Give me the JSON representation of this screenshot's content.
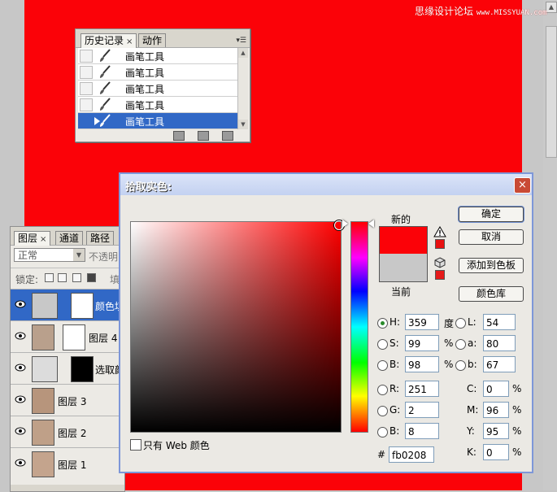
{
  "watermark": {
    "cn": "思缘设计论坛",
    "url": "www.MISSYUAN.com"
  },
  "colors": {
    "current_fg": "#fb0208",
    "previous": "#c8c8c8",
    "warn_swatch": "#e81010",
    "cube_swatch": "#e51a1a",
    "selection": "#3168c6"
  },
  "history_panel": {
    "tabs": [
      {
        "label": "历史记录",
        "close": "×"
      },
      {
        "label": "动作"
      }
    ],
    "menu_icon": "panel-menu-icon",
    "items": [
      {
        "label": "画笔工具"
      },
      {
        "label": "画笔工具"
      },
      {
        "label": "画笔工具"
      },
      {
        "label": "画笔工具"
      },
      {
        "label": "画笔工具",
        "selected": true
      }
    ]
  },
  "layers_panel": {
    "tabs": [
      {
        "label": "图层",
        "close": "×"
      },
      {
        "label": "通道"
      },
      {
        "label": "路径"
      }
    ],
    "blend_mode": "正常",
    "opacity_label": "不透明",
    "lock_label": "锁定:",
    "fill_label": "填",
    "layers": [
      {
        "name": "颜色填",
        "selected": true
      },
      {
        "name": "图层 4"
      },
      {
        "name": "选取颜"
      },
      {
        "name": "图层 3"
      },
      {
        "name": "图层 2"
      },
      {
        "name": "图层 1"
      }
    ]
  },
  "color_picker": {
    "title": "拾取实色:",
    "close": "×",
    "new_label": "新的",
    "current_label": "当前",
    "buttons": {
      "ok": "确定",
      "cancel": "取消",
      "add_swatch": "添加到色板",
      "libraries": "颜色库"
    },
    "hsb": [
      {
        "key": "H:",
        "value": "359",
        "unit": "度",
        "selected": true
      },
      {
        "key": "S:",
        "value": "99",
        "unit": "%"
      },
      {
        "key": "B:",
        "value": "98",
        "unit": "%"
      }
    ],
    "lab": [
      {
        "key": "L:",
        "value": "54"
      },
      {
        "key": "a:",
        "value": "80"
      },
      {
        "key": "b:",
        "value": "67"
      }
    ],
    "rgb": [
      {
        "key": "R:",
        "value": "251"
      },
      {
        "key": "G:",
        "value": "2"
      },
      {
        "key": "B:",
        "value": "8"
      }
    ],
    "cmyk": [
      {
        "key": "C:",
        "value": "0",
        "unit": "%"
      },
      {
        "key": "M:",
        "value": "96",
        "unit": "%"
      },
      {
        "key": "Y:",
        "value": "95",
        "unit": "%"
      },
      {
        "key": "K:",
        "value": "0",
        "unit": "%"
      }
    ],
    "hex_label": "#",
    "hex": "fb0208",
    "web_only_label": "只有 Web 颜色"
  }
}
